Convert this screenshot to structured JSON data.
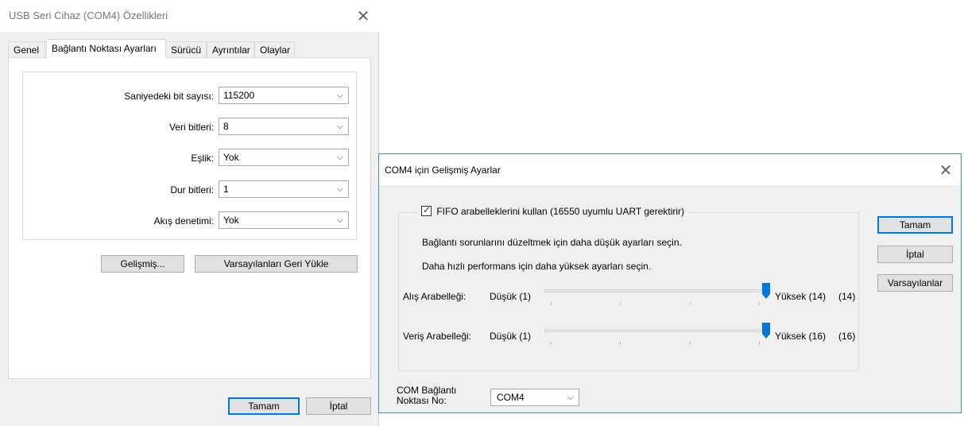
{
  "properties_dialog": {
    "title": "USB Seri Cihaz (COM4) Özellikleri",
    "tabs": [
      "Genel",
      "Bağlantı Noktası Ayarları",
      "Sürücü",
      "Ayrıntılar",
      "Olaylar"
    ],
    "active_tab": "Bağlantı Noktası Ayarları",
    "fields": [
      {
        "label": "Saniyedeki bit sayısı:",
        "value": "115200"
      },
      {
        "label": "Veri bitleri:",
        "value": "8"
      },
      {
        "label": "Eşlik:",
        "value": "Yok"
      },
      {
        "label": "Dur bitleri:",
        "value": "1"
      },
      {
        "label": "Akış denetimi:",
        "value": "Yok"
      }
    ],
    "advanced_button": "Gelişmiş...",
    "restore_button": "Varsayılanları Geri Yükle",
    "ok_button": "Tamam",
    "cancel_button": "İptal"
  },
  "advanced_dialog": {
    "title": "COM4 için Gelişmiş Ayarlar",
    "fifo_checkbox_label": "FIFO arabelleklerini kullan (16550 uyumlu UART gerektirir)",
    "fifo_checked": true,
    "hint_lower": "Bağlantı sorunlarını düzeltmek için daha düşük ayarları seçin.",
    "hint_higher": "Daha hızlı performans için daha yüksek ayarları seçin.",
    "receive_buffer": {
      "label": "Alış Arabelleği:",
      "low": "Düşük (1)",
      "high": "Yüksek (14)",
      "current": "(14)",
      "min": 1,
      "max": 14,
      "value": 14
    },
    "transmit_buffer": {
      "label": "Veriş Arabelleği:",
      "low": "Düşük (1)",
      "high": "Yüksek (16)",
      "current": "(16)",
      "min": 1,
      "max": 16,
      "value": 16
    },
    "com_port_label_line1": "COM Bağlantı",
    "com_port_label_line2": "Noktası No:",
    "com_port_value": "COM4",
    "ok_button": "Tamam",
    "cancel_button": "İptal",
    "defaults_button": "Varsayılanlar"
  },
  "accent_color": "#0078d7",
  "icons": [
    "close-icon",
    "chevron-down-icon",
    "checkmark-icon",
    "slider-thumb-icon"
  ]
}
